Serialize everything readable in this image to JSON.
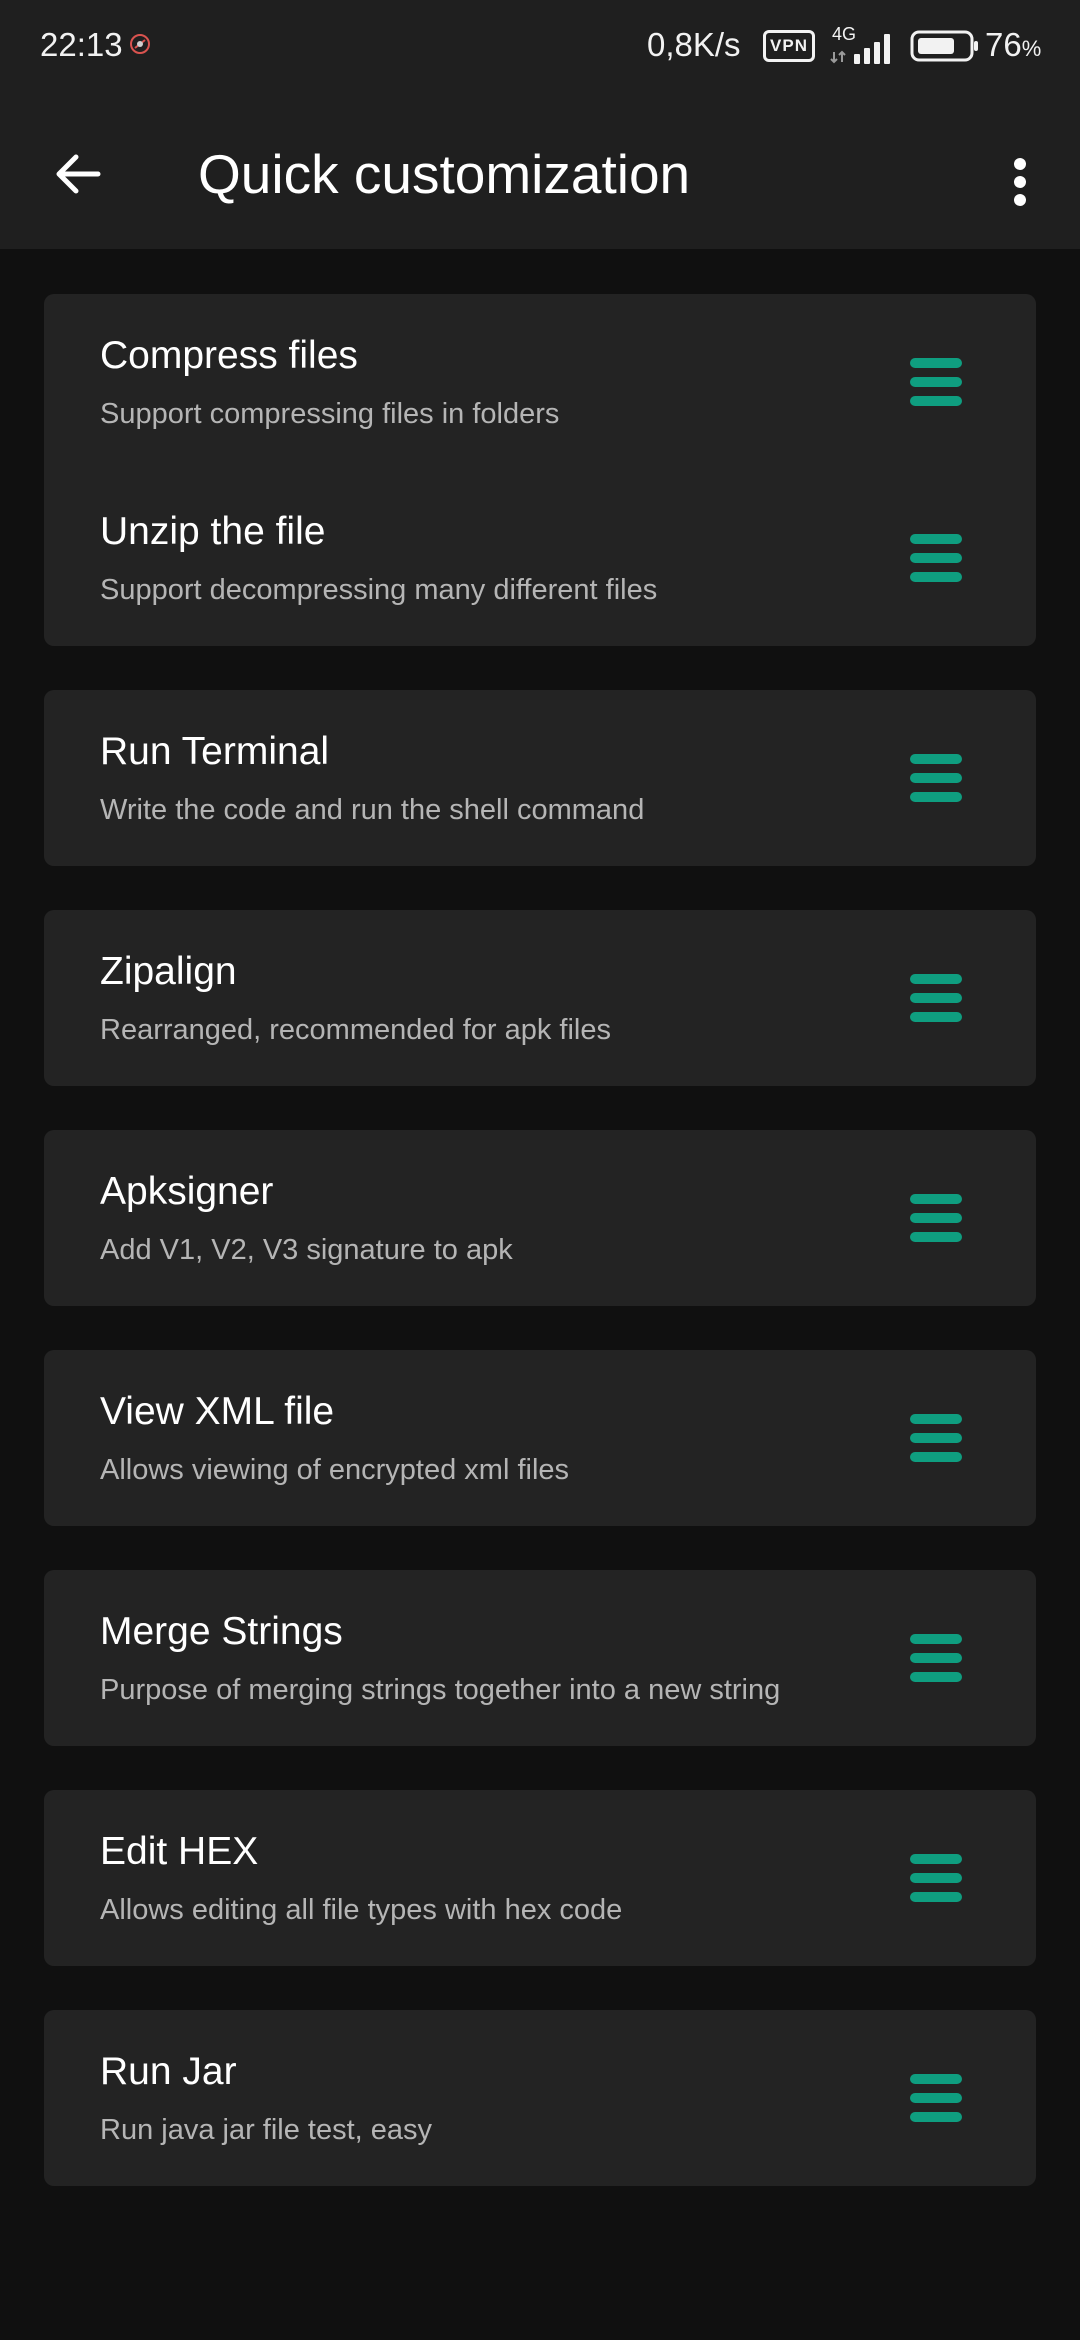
{
  "status_bar": {
    "time": "22:13",
    "speed": "0,8K/s",
    "vpn": "VPN",
    "network": "4G",
    "battery_level": "76",
    "battery_unit": "%"
  },
  "toolbar": {
    "title": "Quick customization"
  },
  "colors": {
    "accent": "#0f9e80",
    "card": "#232323",
    "background": "#101010",
    "bar": "#1f1f1f"
  },
  "items": [
    {
      "title": "Compress files",
      "subtitle": "Support compressing files in folders"
    },
    {
      "title": "Unzip the file",
      "subtitle": "Support decompressing many different files"
    },
    {
      "title": "Run Terminal",
      "subtitle": "Write the code and run the shell command"
    },
    {
      "title": "Zipalign",
      "subtitle": "Rearranged, recommended for apk files"
    },
    {
      "title": "Apksigner",
      "subtitle": "Add V1, V2, V3 signature to apk"
    },
    {
      "title": "View XML file",
      "subtitle": "Allows viewing of encrypted xml files"
    },
    {
      "title": "Merge Strings",
      "subtitle": "Purpose of merging strings together into a new string"
    },
    {
      "title": "Edit HEX",
      "subtitle": "Allows editing all file types with hex code"
    },
    {
      "title": "Run Jar",
      "subtitle": "Run java jar file test, easy"
    }
  ]
}
